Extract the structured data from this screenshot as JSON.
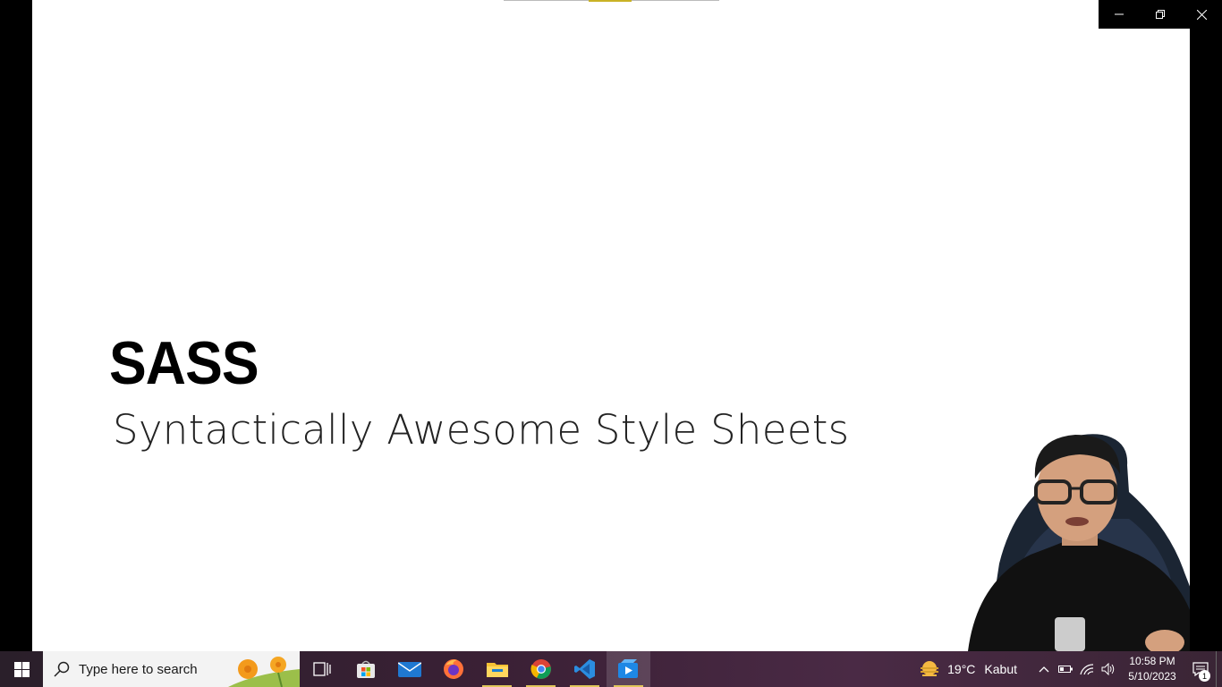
{
  "slide": {
    "title": "SASS",
    "subtitle": "Syntactically Awesome Style Sheets"
  },
  "window_controls": {
    "minimize_icon": "minimize-icon",
    "restore_icon": "restore-icon",
    "close_icon": "close-icon"
  },
  "taskbar": {
    "search_placeholder": "Type here to search",
    "apps": [
      "task-view",
      "microsoft-store",
      "mail",
      "firefox",
      "file-explorer",
      "chrome",
      "vscode",
      "video-player"
    ],
    "weather": {
      "temp": "19°C",
      "condition": "Kabut"
    },
    "clock": {
      "time": "10:58 PM",
      "date": "5/10/2023"
    },
    "notification_count": "1"
  },
  "colors": {
    "taskbar": "#3a2035",
    "accent_underline": "#e0c65a",
    "progress_fill": "#c9b225"
  }
}
